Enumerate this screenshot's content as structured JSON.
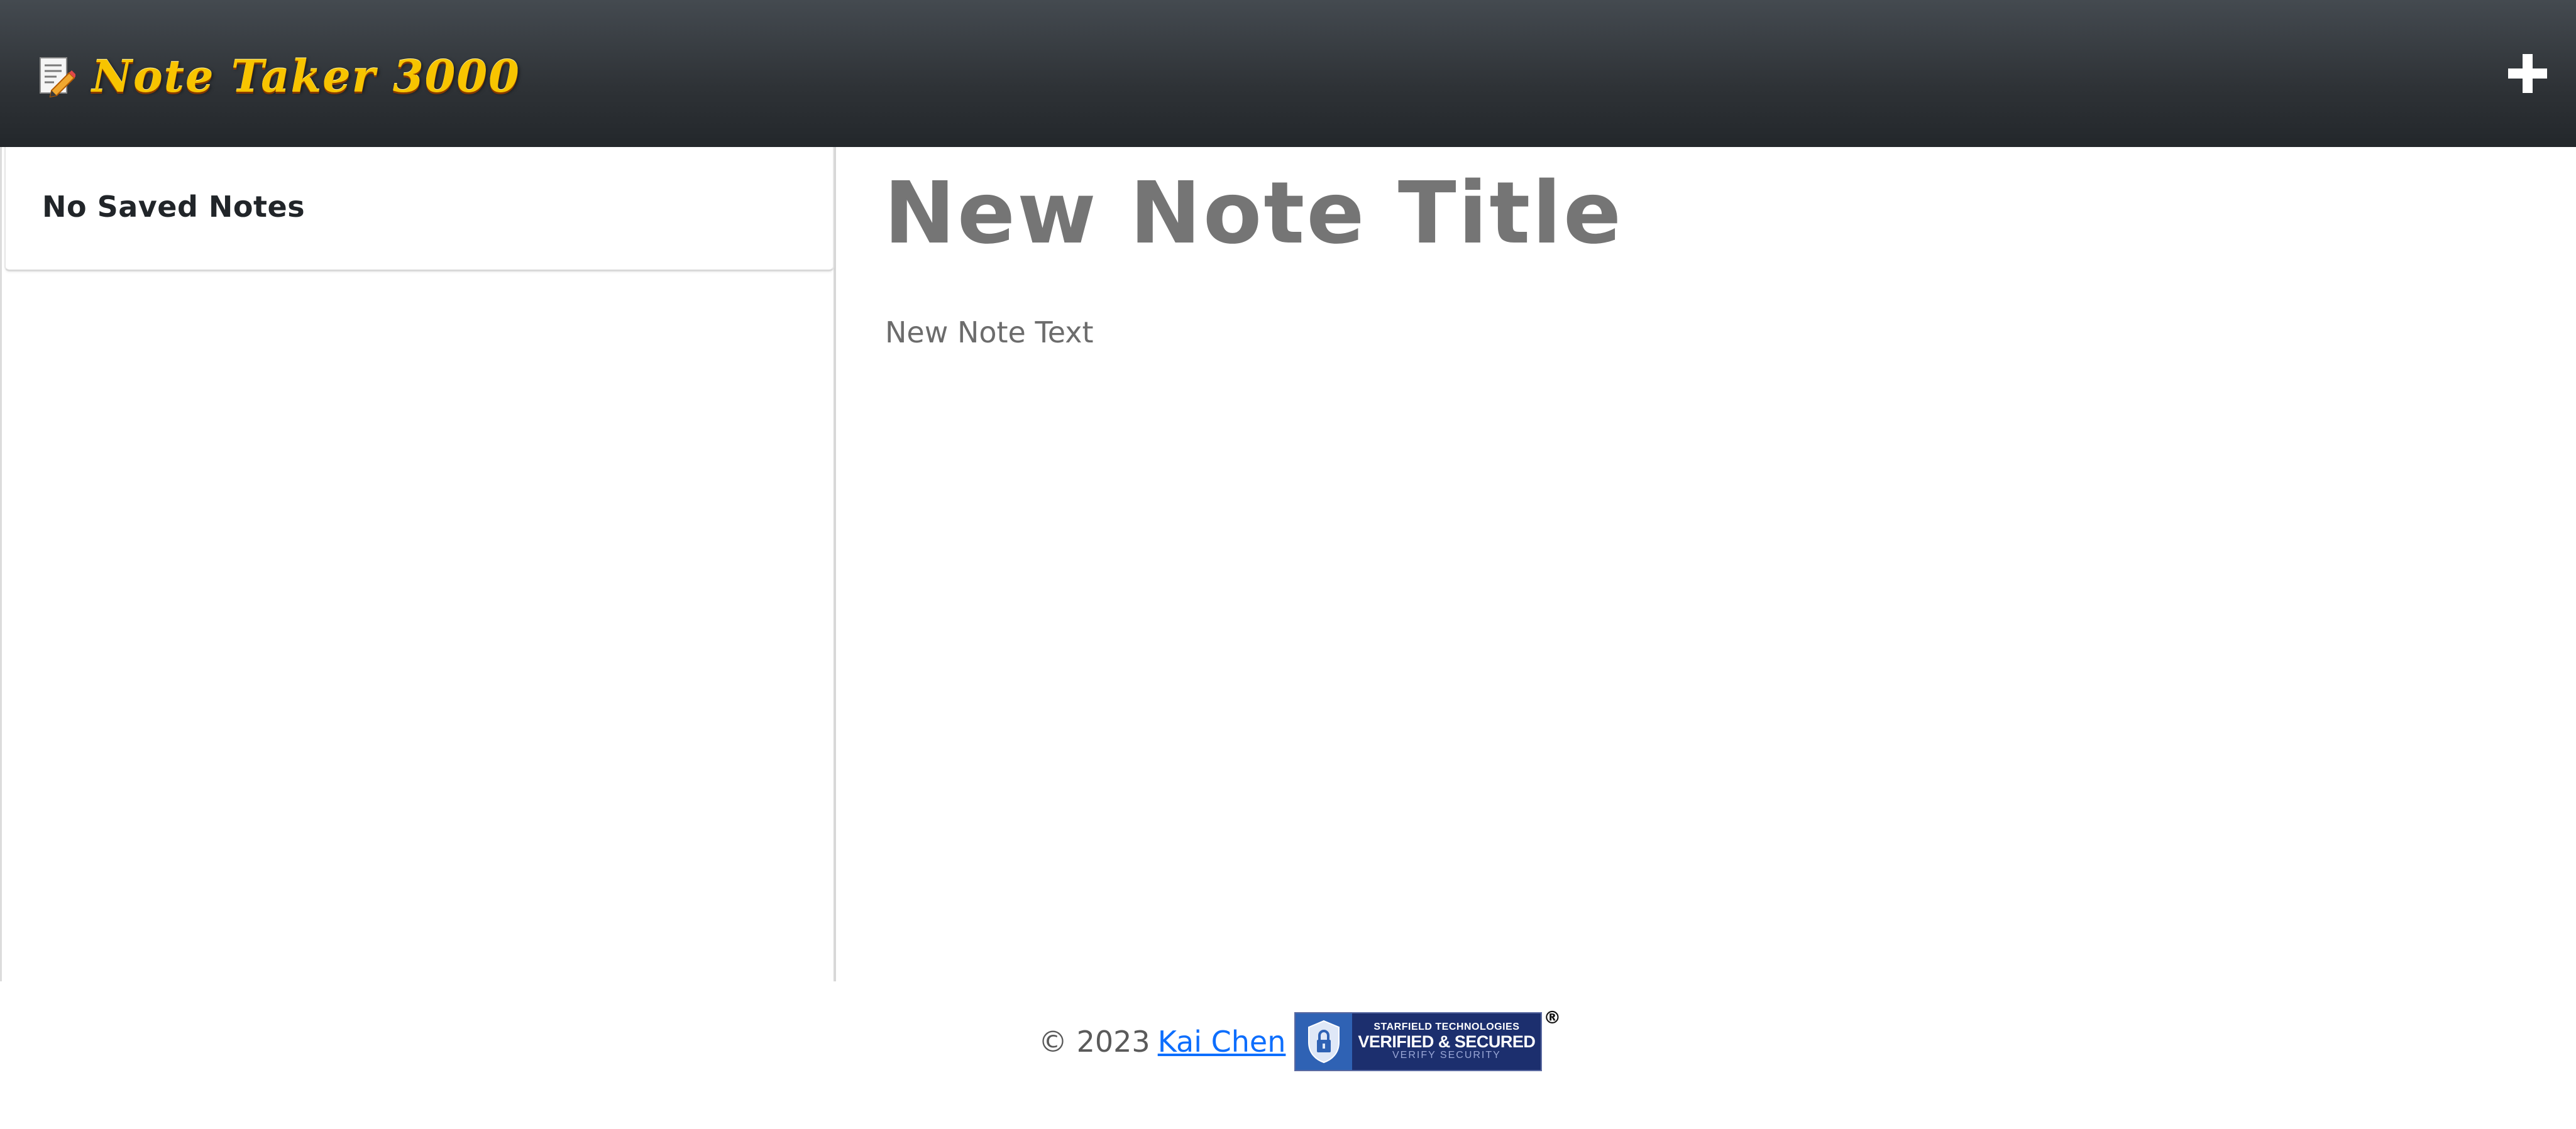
{
  "header": {
    "app_title": "Note Taker 3000",
    "brand_icon": "note-pencil-icon",
    "add_icon": "plus-icon"
  },
  "sidebar": {
    "empty_message": "No Saved Notes"
  },
  "editor": {
    "title_placeholder": "New Note Title",
    "text_placeholder": "New Note Text"
  },
  "footer": {
    "copyright": "© 2023",
    "author": "Kai Chen",
    "seal": {
      "line1": "STARFIELD TECHNOLOGIES",
      "line2": "VERIFIED & SECURED",
      "line3": "VERIFY SECURITY",
      "registered": "®"
    }
  },
  "colors": {
    "header_bg": "#2e3236",
    "brand_title": "#f7c400",
    "link": "#0d6efd",
    "title_text": "#757575",
    "seal_bg": "#1c2f6e"
  }
}
